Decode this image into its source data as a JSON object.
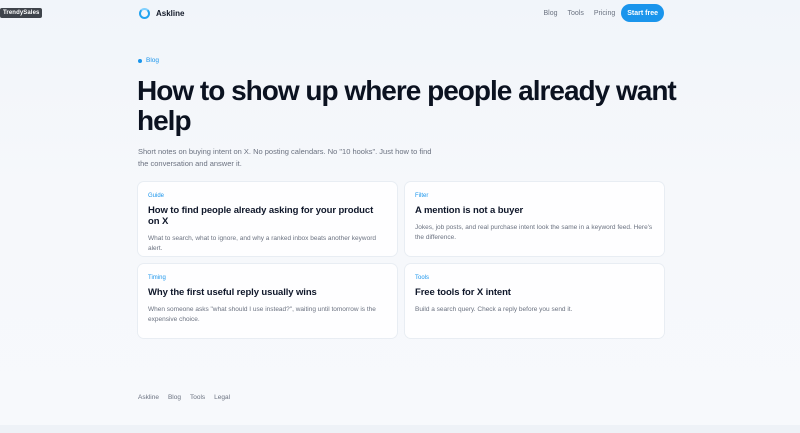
{
  "badge": "TrendySales",
  "header": {
    "brand": "Askline",
    "nav": [
      {
        "label": "Blog"
      },
      {
        "label": "Tools"
      },
      {
        "label": "Pricing"
      }
    ],
    "cta": "Start free"
  },
  "hero": {
    "kicker": "Blog",
    "title": "How to show up where people already want help",
    "lede": "Short notes on buying intent on X. No posting calendars. No \"10 hooks\". Just how to find the conversation and answer it."
  },
  "cards": [
    {
      "tag": "Guide",
      "title": "How to find people already asking for your product on X",
      "desc": "What to search, what to ignore, and why a ranked inbox beats another keyword alert."
    },
    {
      "tag": "Filter",
      "title": "A mention is not a buyer",
      "desc": "Jokes, job posts, and real purchase intent look the same in a keyword feed. Here's the difference."
    },
    {
      "tag": "Timing",
      "title": "Why the first useful reply usually wins",
      "desc": "When someone asks \"what should I use instead?\", waiting until tomorrow is the expensive choice."
    },
    {
      "tag": "Tools",
      "title": "Free tools for X intent",
      "desc": "Build a search query. Check a reply before you send it."
    }
  ],
  "footer": {
    "links": [
      {
        "label": "Askline"
      },
      {
        "label": "Blog"
      },
      {
        "label": "Tools"
      },
      {
        "label": "Legal"
      }
    ]
  },
  "colors": {
    "accent": "#1a95ec",
    "text": "#0f172a",
    "muted": "#6b7280"
  }
}
